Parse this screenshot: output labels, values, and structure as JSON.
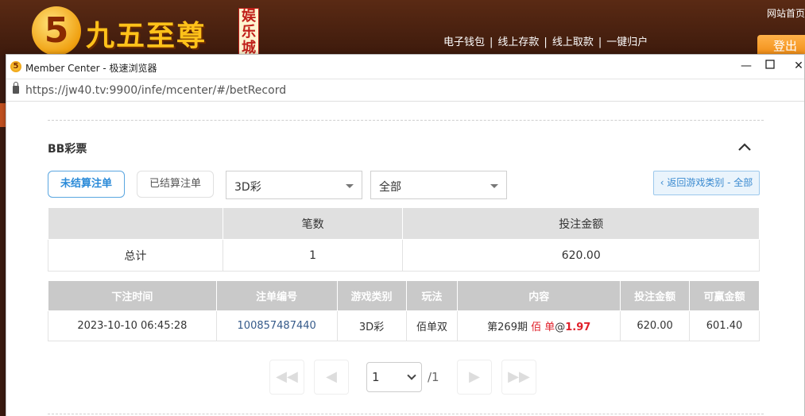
{
  "site": {
    "logo_numeral": "5",
    "logo_text": "九五至尊",
    "logo_tag": "娱乐城",
    "top_links": [
      "电子钱包",
      "线上存款",
      "线上取款",
      "一键归户"
    ],
    "home_link": "网站首页",
    "logout": "登出"
  },
  "window": {
    "title": "Member Center - 极速浏览器",
    "url": "https://jw40.tv:9900/infe/mcenter/#/betRecord"
  },
  "section": {
    "title": "BB彩票",
    "tabs": {
      "unsettled": "未结算注单",
      "settled": "已结算注单"
    },
    "filter_game": "3D彩",
    "filter_type": "全部",
    "back_button": "‹ 返回游戏类别 - 全部"
  },
  "summary": {
    "headers": [
      "",
      "笔数",
      "投注金额"
    ],
    "row": {
      "label": "总计",
      "count": "1",
      "amount": "620.00"
    }
  },
  "detail": {
    "headers": [
      "下注时间",
      "注单编号",
      "游戏类别",
      "玩法",
      "内容",
      "投注金额",
      "可赢金额"
    ],
    "row": {
      "time": "2023-10-10 06:45:28",
      "bet_no": "100857487440",
      "game": "3D彩",
      "play": "佰单双",
      "content_period": "第269期",
      "content_pick": "佰 单",
      "content_odds_prefix": "@",
      "content_odds": "1.97",
      "bet_amount": "620.00",
      "win_amount": "601.40"
    }
  },
  "pager": {
    "current": "1",
    "total": "/1"
  },
  "colors": {
    "accent_blue": "#2a8ad8",
    "red": "#e0202a",
    "header_gray": "#c9c9c9"
  }
}
